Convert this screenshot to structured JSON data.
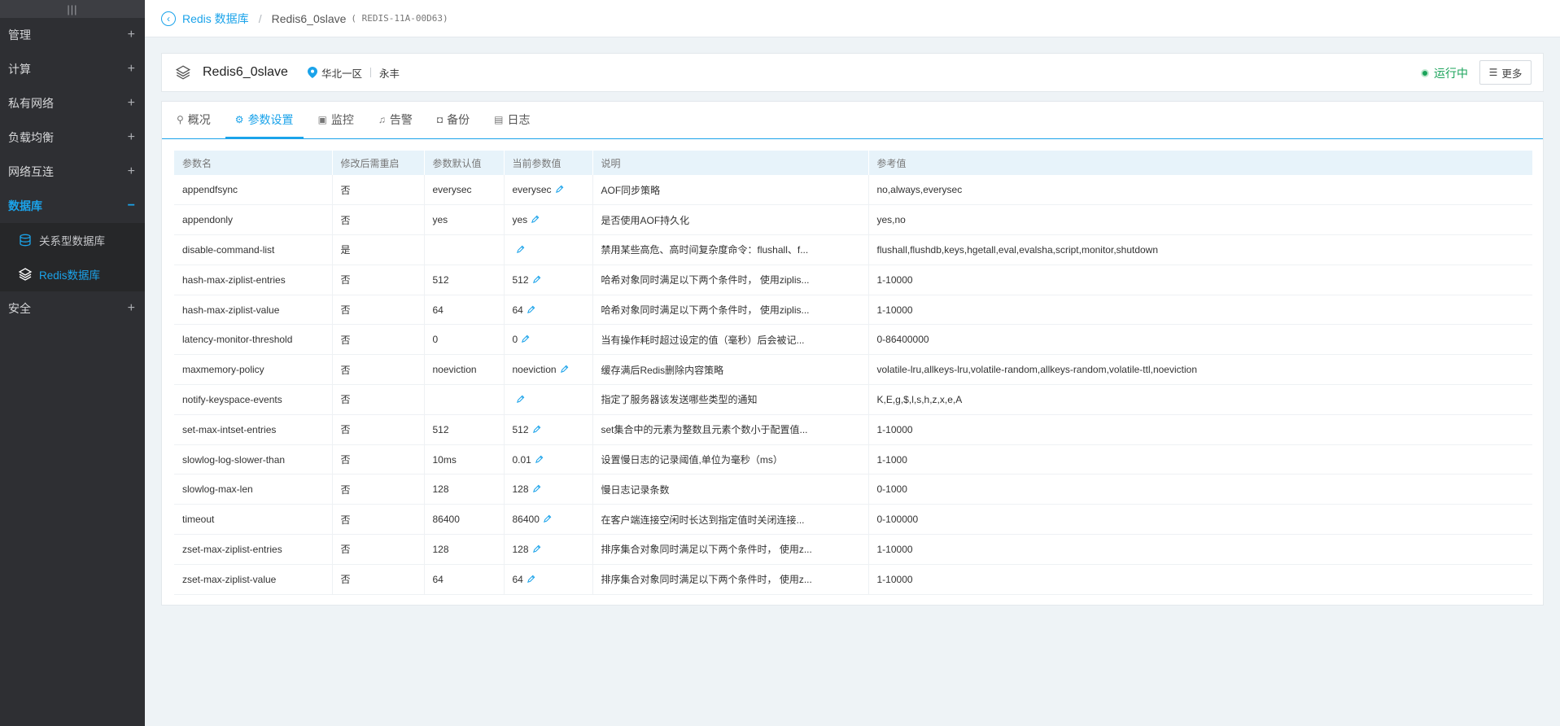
{
  "sidebar": {
    "handle": "|||",
    "menu": [
      {
        "label": "管理",
        "expander": "+"
      },
      {
        "label": "计算",
        "expander": "+"
      },
      {
        "label": "私有网络",
        "expander": "+"
      },
      {
        "label": "负载均衡",
        "expander": "+"
      },
      {
        "label": "网络互连",
        "expander": "+"
      }
    ],
    "database": {
      "label": "数据库",
      "expander": "−",
      "children": [
        {
          "label": "关系型数据库"
        },
        {
          "label": "Redis数据库"
        }
      ]
    },
    "security": {
      "label": "安全",
      "expander": "+"
    }
  },
  "breadcrumb": {
    "back_glyph": "‹",
    "parent": "Redis 数据库",
    "separator": "/",
    "current": "Redis6_0slave",
    "id_open": "(",
    "id": "REDIS-11A-00D63",
    "id_close": ")"
  },
  "instance": {
    "name": "Redis6_0slave",
    "region": "华北一区",
    "zone": "永丰",
    "status": "运行中",
    "status_color": "#1aa35a",
    "more_label": "更多",
    "more_glyph": "☰"
  },
  "tabs": [
    {
      "label": "概况",
      "glyph": "⚲"
    },
    {
      "label": "参数设置",
      "glyph": "⚙"
    },
    {
      "label": "监控",
      "glyph": "▣"
    },
    {
      "label": "告警",
      "glyph": "♫"
    },
    {
      "label": "备份",
      "glyph": "◘"
    },
    {
      "label": "日志",
      "glyph": "▤"
    }
  ],
  "active_tab": 1,
  "table": {
    "headers": [
      "参数名",
      "修改后需重启",
      "参数默认值",
      "当前参数值",
      "说明",
      "参考值"
    ],
    "rows": [
      {
        "name": "appendfsync",
        "restart": "否",
        "default": "everysec",
        "current": "everysec",
        "desc": "AOF同步策略",
        "ref": "no,always,everysec"
      },
      {
        "name": "appendonly",
        "restart": "否",
        "default": "yes",
        "current": "yes",
        "desc": "是否使用AOF持久化",
        "ref": "yes,no"
      },
      {
        "name": "disable-command-list",
        "restart": "是",
        "default": "",
        "current": "",
        "desc": "禁用某些高危、高时间复杂度命令：flushall、f...",
        "ref": "flushall,flushdb,keys,hgetall,eval,evalsha,script,monitor,shutdown"
      },
      {
        "name": "hash-max-ziplist-entries",
        "restart": "否",
        "default": "512",
        "current": "512",
        "desc": "哈希对象同时满足以下两个条件时， 使用ziplis...",
        "ref": "1-10000"
      },
      {
        "name": "hash-max-ziplist-value",
        "restart": "否",
        "default": "64",
        "current": "64",
        "desc": "哈希对象同时满足以下两个条件时， 使用ziplis...",
        "ref": "1-10000"
      },
      {
        "name": "latency-monitor-threshold",
        "restart": "否",
        "default": "0",
        "current": "0",
        "desc": "当有操作耗时超过设定的值（毫秒）后会被记...",
        "ref": "0-86400000"
      },
      {
        "name": "maxmemory-policy",
        "restart": "否",
        "default": "noeviction",
        "current": "noeviction",
        "desc": "缓存满后Redis删除内容策略",
        "ref": "volatile-lru,allkeys-lru,volatile-random,allkeys-random,volatile-ttl,noeviction"
      },
      {
        "name": "notify-keyspace-events",
        "restart": "否",
        "default": "",
        "current": "",
        "desc": "指定了服务器该发送哪些类型的通知",
        "ref": "K,E,g,$,l,s,h,z,x,e,A"
      },
      {
        "name": "set-max-intset-entries",
        "restart": "否",
        "default": "512",
        "current": "512",
        "desc": "set集合中的元素为整数且元素个数小于配置值...",
        "ref": "1-10000"
      },
      {
        "name": "slowlog-log-slower-than",
        "restart": "否",
        "default": "10ms",
        "current": "0.01",
        "desc": "设置慢日志的记录阈值,单位为毫秒（ms）",
        "ref": "1-1000"
      },
      {
        "name": "slowlog-max-len",
        "restart": "否",
        "default": "128",
        "current": "128",
        "desc": "慢日志记录条数",
        "ref": "0-1000"
      },
      {
        "name": "timeout",
        "restart": "否",
        "default": "86400",
        "current": "86400",
        "desc": "在客户端连接空闲时长达到指定值时关闭连接...",
        "ref": "0-100000"
      },
      {
        "name": "zset-max-ziplist-entries",
        "restart": "否",
        "default": "128",
        "current": "128",
        "desc": "排序集合对象同时满足以下两个条件时， 使用z...",
        "ref": "1-10000"
      },
      {
        "name": "zset-max-ziplist-value",
        "restart": "否",
        "default": "64",
        "current": "64",
        "desc": "排序集合对象同时满足以下两个条件时， 使用z...",
        "ref": "1-10000"
      }
    ]
  },
  "colors": {
    "accent": "#1ba3ea",
    "sidebar_bg": "#2e2f33",
    "page_bg": "#eef3f6"
  }
}
